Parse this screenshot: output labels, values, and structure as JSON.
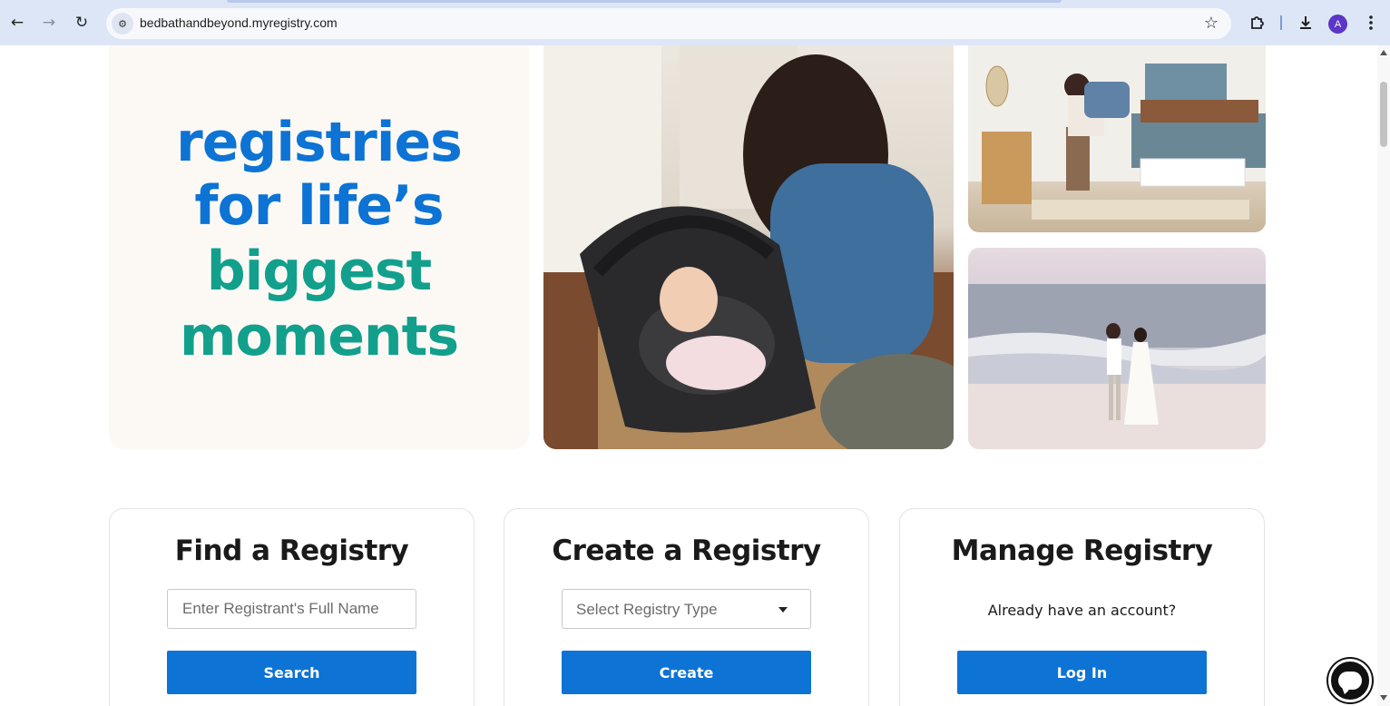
{
  "browser": {
    "url": "bedbathandbeyond.myregistry.com",
    "avatar_letter": "A",
    "icons": {
      "back": "back-arrow-icon",
      "forward": "forward-arrow-icon",
      "reload": "reload-icon",
      "site_info": "site-info-icon",
      "bookmark": "star-icon",
      "extensions": "puzzle-icon",
      "downloads": "download-icon",
      "menu": "kebab-menu-icon"
    }
  },
  "hero": {
    "line1": "registries",
    "line2": "for life’s",
    "line3": "biggest",
    "line4": "moments",
    "colors": {
      "blue": "#0d73d4",
      "teal": "#12a08c",
      "panel_bg": "#fcf9f5"
    }
  },
  "cards": {
    "find": {
      "title": "Find a Registry",
      "placeholder": "Enter Registrant's Full Name",
      "button": "Search"
    },
    "create": {
      "title": "Create a Registry",
      "select_value": "Select Registry Type",
      "button": "Create"
    },
    "manage": {
      "title": "Manage Registry",
      "text": "Already have an account?",
      "button": "Log In"
    }
  },
  "theme": {
    "button_color": "#0d73d4"
  },
  "chat": {
    "icon": "chat-bubble-icon"
  }
}
